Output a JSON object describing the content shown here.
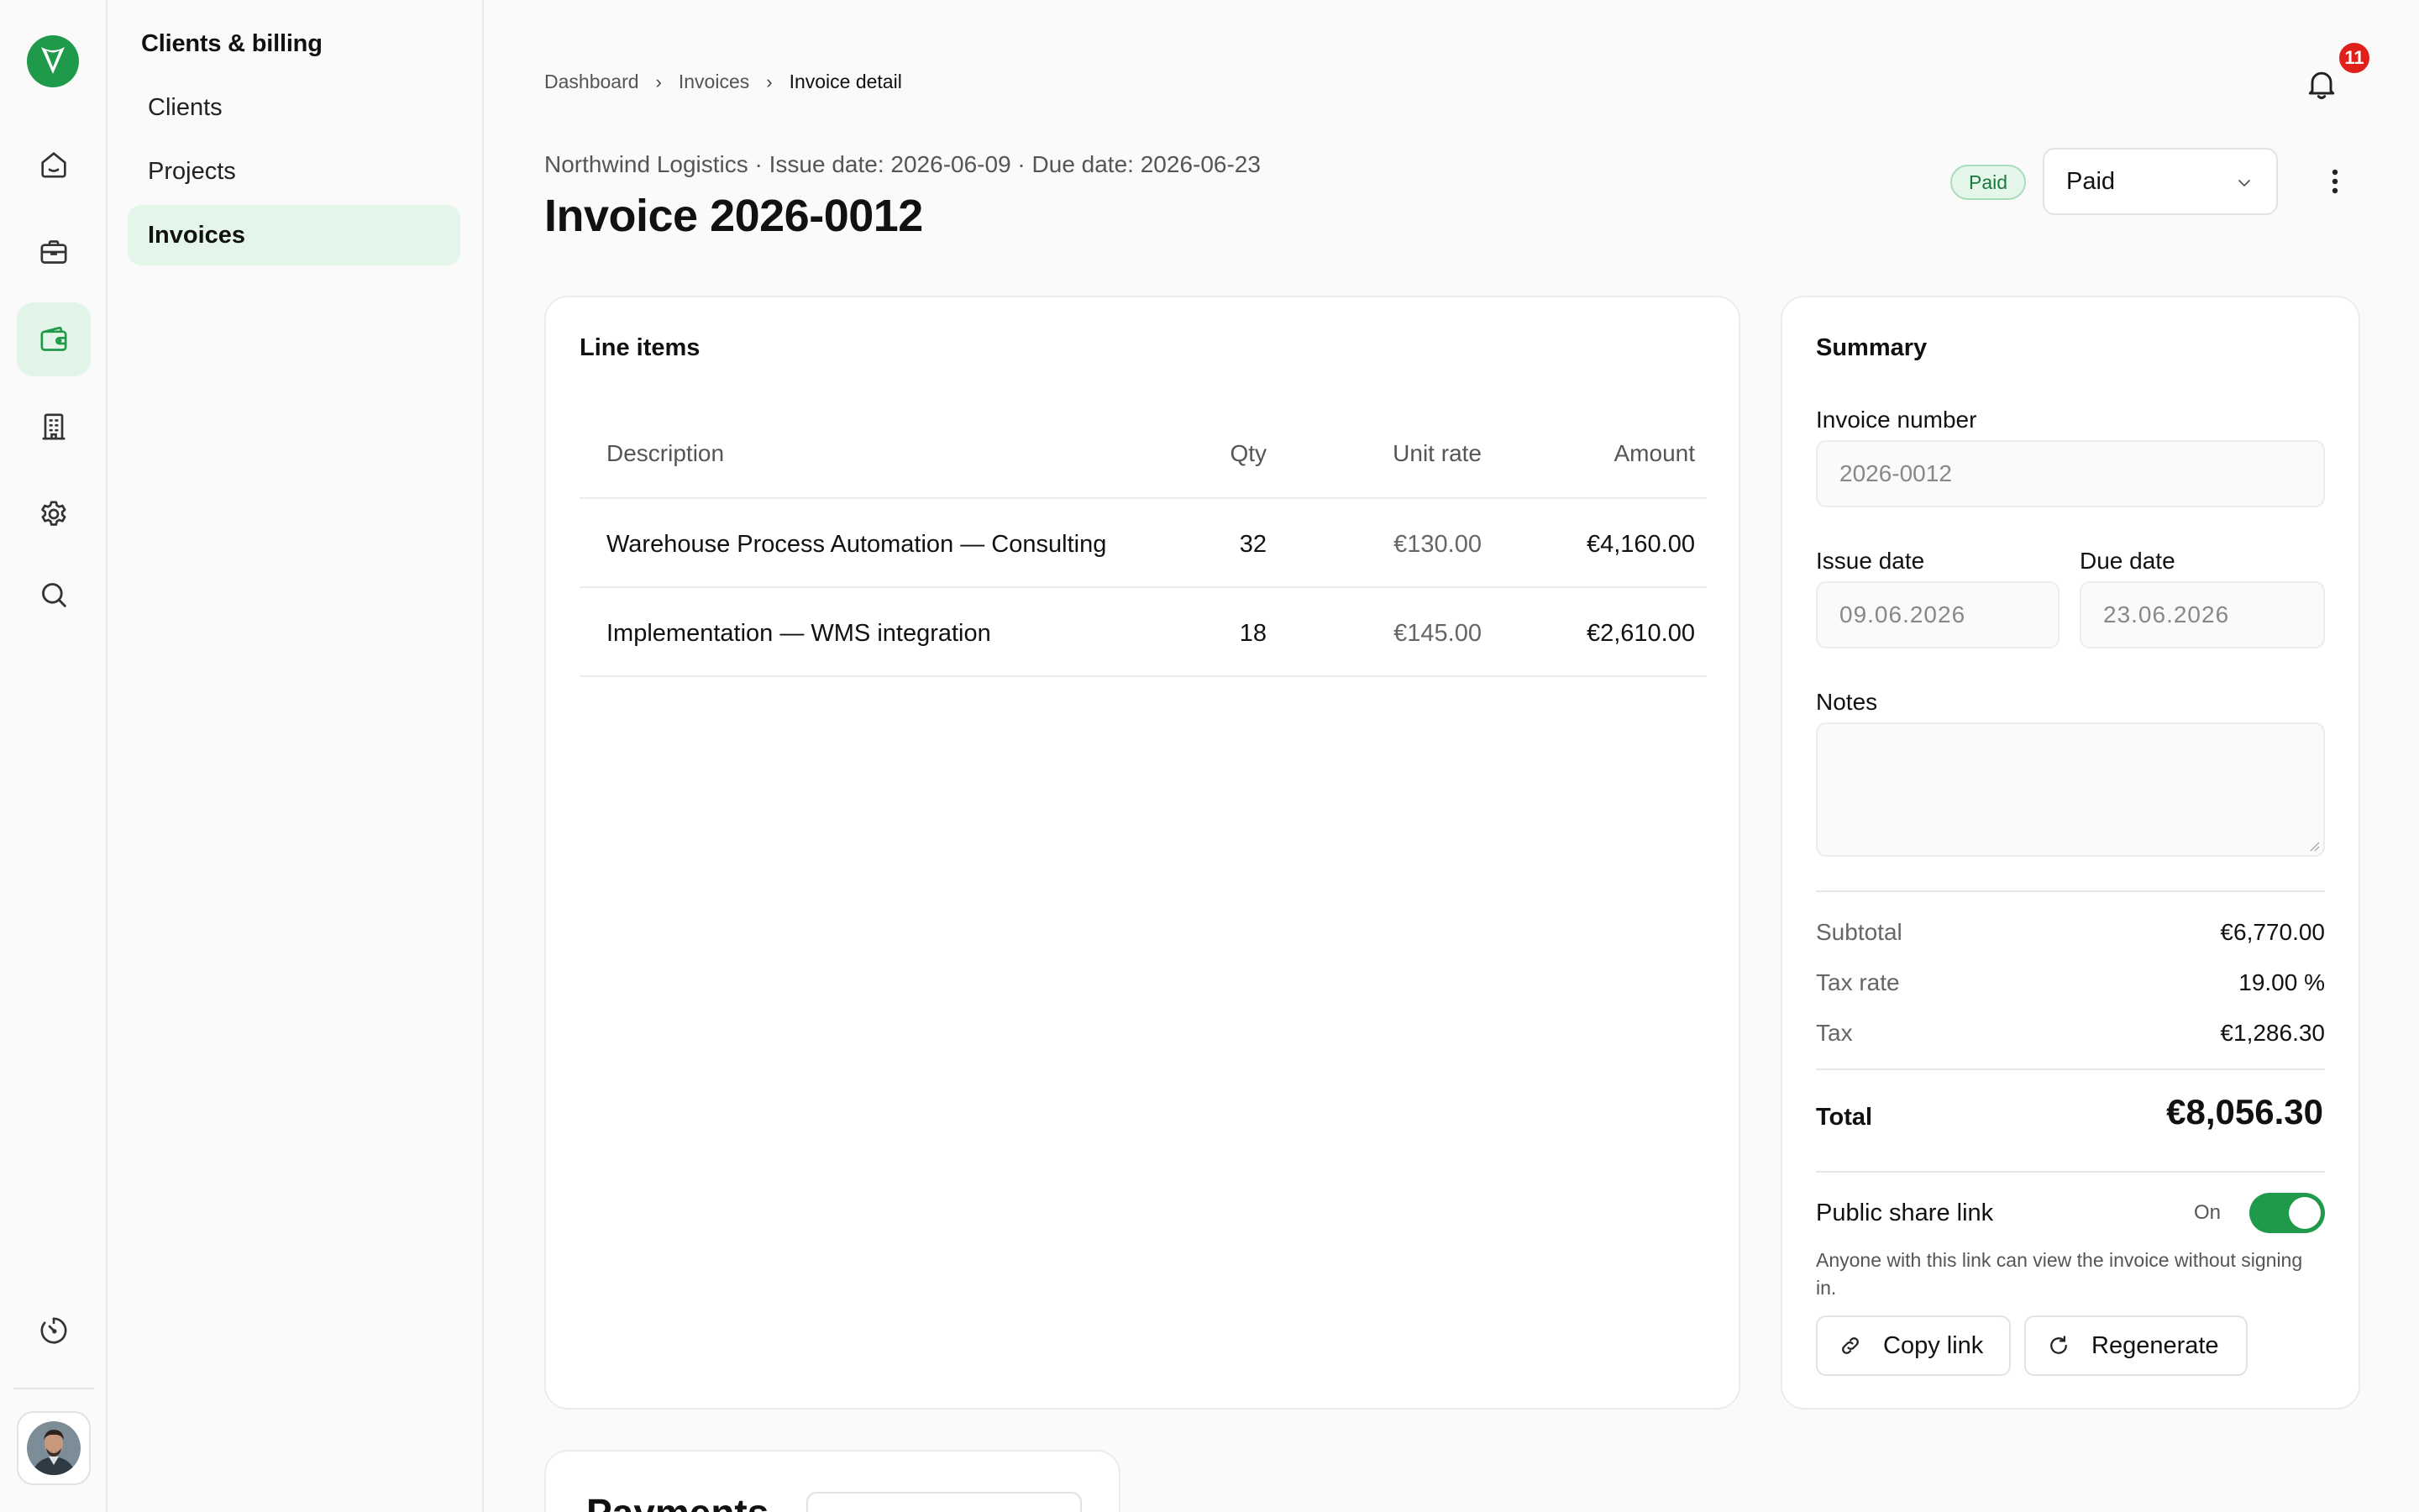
{
  "rail": {
    "active_index": 2,
    "icons": [
      "home-icon",
      "briefcase-icon",
      "wallet-icon",
      "building-icon",
      "gear-icon",
      "search-icon"
    ],
    "bottom_icon": "timer-icon",
    "brand_color": "#1f9a4a"
  },
  "subnav": {
    "title": "Clients & billing",
    "items": [
      {
        "label": "Clients"
      },
      {
        "label": "Projects"
      },
      {
        "label": "Invoices",
        "active": true
      }
    ]
  },
  "breadcrumb": {
    "items": [
      "Dashboard",
      "Invoices",
      "Invoice detail"
    ]
  },
  "notifications": {
    "count": "11"
  },
  "header": {
    "meta": "Northwind Logistics · Issue date: 2026-06-09 · Due date: 2026-06-23",
    "title": "Invoice 2026-0012",
    "status_badge": "Paid",
    "status_select": "Paid"
  },
  "line_items": {
    "title": "Line items",
    "columns": {
      "description": "Description",
      "qty": "Qty",
      "rate": "Unit rate",
      "amount": "Amount"
    },
    "rows": [
      {
        "description": "Warehouse Process Automation — Consulting",
        "qty": "32",
        "rate": "€130.00",
        "amount": "€4,160.00"
      },
      {
        "description": "Implementation — WMS integration",
        "qty": "18",
        "rate": "€145.00",
        "amount": "€2,610.00"
      }
    ]
  },
  "summary": {
    "title": "Summary",
    "invoice_number_label": "Invoice number",
    "invoice_number_placeholder": "2026-0012",
    "issue_date_label": "Issue date",
    "issue_date_placeholder": "09.06.2026",
    "due_date_label": "Due date",
    "due_date_placeholder": "23.06.2026",
    "notes_label": "Notes",
    "subtotal_label": "Subtotal",
    "subtotal_value": "€6,770.00",
    "tax_rate_label": "Tax rate",
    "tax_rate_value": "19.00 %",
    "tax_label": "Tax",
    "tax_value": "€1,286.30",
    "total_label": "Total",
    "total_value": "€8,056.30",
    "share_label": "Public share link",
    "share_state": "On",
    "share_enabled": true,
    "share_help": "Anyone with this link can view the invoice without signing in.",
    "copy_link": "Copy link",
    "regenerate": "Regenerate"
  },
  "payments": {
    "title": "Payments"
  }
}
